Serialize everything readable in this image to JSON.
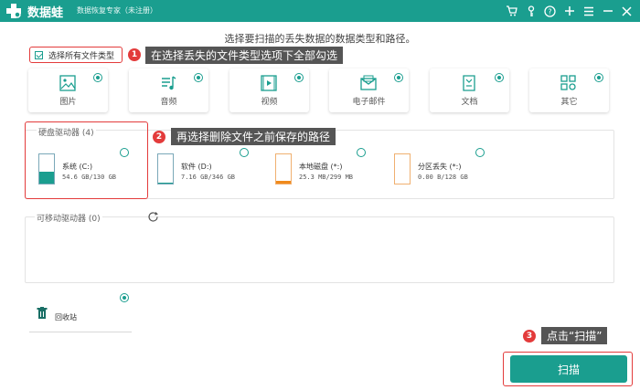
{
  "window": {
    "app_name": "数据蛙",
    "app_subtitle": "数据恢复专家（未注册）",
    "toolbar_icons": [
      "cart-icon",
      "key-icon",
      "help-icon",
      "plus-icon",
      "menu-icon",
      "minimize-icon",
      "close-icon"
    ]
  },
  "instruction": "选择要扫描的丢失数据的数据类型和路径。",
  "select_all": {
    "label": "选择所有文件类型",
    "checked": true
  },
  "file_types": [
    {
      "label": "图片",
      "icon": "image-icon",
      "checked": true
    },
    {
      "label": "音频",
      "icon": "audio-icon",
      "checked": true
    },
    {
      "label": "视频",
      "icon": "video-icon",
      "checked": true
    },
    {
      "label": "电子邮件",
      "icon": "email-icon",
      "checked": true
    },
    {
      "label": "文档",
      "icon": "document-icon",
      "checked": true
    },
    {
      "label": "其它",
      "icon": "other-icon",
      "checked": true
    }
  ],
  "callouts": [
    {
      "num": "1",
      "text": "在选择丢失的文件类型选项下全部勾选"
    },
    {
      "num": "2",
      "text": "再选择删除文件之前保存的路径"
    },
    {
      "num": "3",
      "text": "点击“扫描”"
    }
  ],
  "hard_drives": {
    "title": "硬盘驱动器 (4)",
    "drives": [
      {
        "name": "系统 (C:)",
        "size": "54.6 GB/130 GB",
        "used_fraction": 0.42,
        "color": "#1a9e8f"
      },
      {
        "name": "软件 (D:)",
        "size": "7.16 GB/346 GB",
        "used_fraction": 0.02,
        "color": "#1a9e8f"
      },
      {
        "name": "本地磁盘 (*:)",
        "size": "25.3 MB/299 MB",
        "used_fraction": 0.09,
        "color": "#f08a1c"
      },
      {
        "name": "分区丢失 (*:)",
        "size": "0.00  B/128 GB",
        "used_fraction": 0.0,
        "color": "#f08a1c"
      }
    ]
  },
  "removable": {
    "title": "可移动驱动器 (0)"
  },
  "recycle_bin": {
    "label": "回收站",
    "checked": true
  },
  "scan_button": {
    "label": "扫描"
  },
  "colors": {
    "accent": "#1a9e8f",
    "highlight": "#e33b3b",
    "callout_bg": "#555555",
    "partition_orange": "#f08a1c"
  }
}
